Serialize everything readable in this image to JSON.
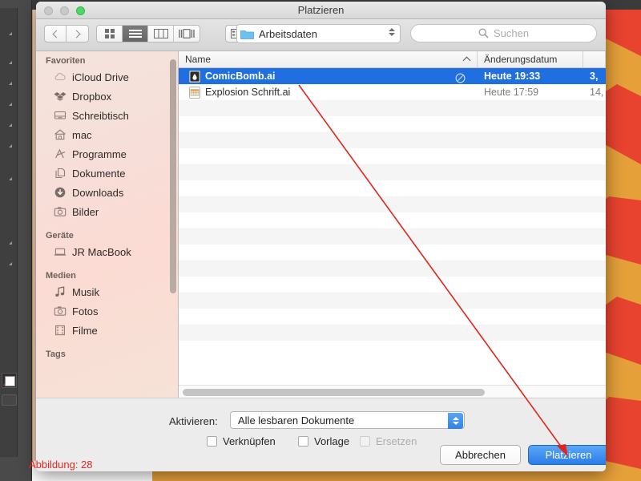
{
  "window": {
    "title": "Platzieren",
    "traffic_lights": [
      "close-button",
      "minimize-button",
      "zoom-button"
    ]
  },
  "toolbar": {
    "back_icon": "chevron-left-icon",
    "forward_icon": "chevron-right-icon",
    "view_modes": [
      {
        "name": "icon-view",
        "active": false
      },
      {
        "name": "list-view",
        "active": true
      },
      {
        "name": "column-view",
        "active": false
      },
      {
        "name": "gallery-view",
        "active": false
      }
    ],
    "arrange_icon": "arrange-grid-icon",
    "path_popup": {
      "label": "Arbeitsdaten",
      "icon": "folder-icon"
    },
    "search": {
      "placeholder": "Suchen",
      "icon": "search-icon",
      "value": ""
    }
  },
  "sidebar": {
    "sections": [
      {
        "heading": "Favoriten",
        "items": [
          {
            "label": "iCloud Drive",
            "icon": "cloud-icon"
          },
          {
            "label": "Dropbox",
            "icon": "dropbox-icon"
          },
          {
            "label": "Schreibtisch",
            "icon": "desktop-icon"
          },
          {
            "label": "mac",
            "icon": "home-icon"
          },
          {
            "label": "Programme",
            "icon": "applications-icon"
          },
          {
            "label": "Dokumente",
            "icon": "documents-icon"
          },
          {
            "label": "Downloads",
            "icon": "downloads-icon"
          },
          {
            "label": "Bilder",
            "icon": "pictures-icon"
          }
        ]
      },
      {
        "heading": "Geräte",
        "items": [
          {
            "label": "JR MacBook",
            "icon": "laptop-icon"
          }
        ]
      },
      {
        "heading": "Medien",
        "items": [
          {
            "label": "Musik",
            "icon": "music-note-icon"
          },
          {
            "label": "Fotos",
            "icon": "camera-icon"
          },
          {
            "label": "Filme",
            "icon": "film-icon"
          }
        ]
      },
      {
        "heading": "Tags",
        "items": []
      }
    ]
  },
  "filelist": {
    "columns": [
      {
        "key": "name",
        "label": "Name",
        "sorted": true,
        "sort_icon": "chevron-up-icon"
      },
      {
        "key": "date",
        "label": "Änderungsdatum"
      },
      {
        "key": "size",
        "label": ""
      }
    ],
    "rows": [
      {
        "name": "ComicBomb.ai",
        "date": "Heute 19:33",
        "size": "3,",
        "icon": "illustrator-ai-file-icon",
        "selected": true,
        "badge": "alias-badge-icon"
      },
      {
        "name": "Explosion Schrift.ai",
        "date": "Heute 17:59",
        "size": "14,",
        "icon": "generic-document-icon",
        "selected": false,
        "badge": ""
      }
    ],
    "empty_row_count": 16
  },
  "bottom": {
    "enable_label": "Aktivieren:",
    "enable_value": "Alle lesbaren Dokumente",
    "checkboxes": [
      {
        "label": "Verknüpfen",
        "checked": false,
        "disabled": false
      },
      {
        "label": "Vorlage",
        "checked": false,
        "disabled": false
      },
      {
        "label": "Ersetzen",
        "checked": false,
        "disabled": true
      }
    ],
    "cancel_label": "Abbrechen",
    "place_label": "Platzieren"
  },
  "annotation": {
    "caption": "Abbildung: 28",
    "arrow_color": "#e1251b",
    "caption_color": "#e8251c"
  },
  "colors": {
    "accent_blue": "#1f6fe0",
    "default_button_blue": "#2a7de9",
    "artwork_orange": "#e5a03a",
    "artwork_red": "#e8432f",
    "sidebar_pink": "#f7ded8"
  }
}
